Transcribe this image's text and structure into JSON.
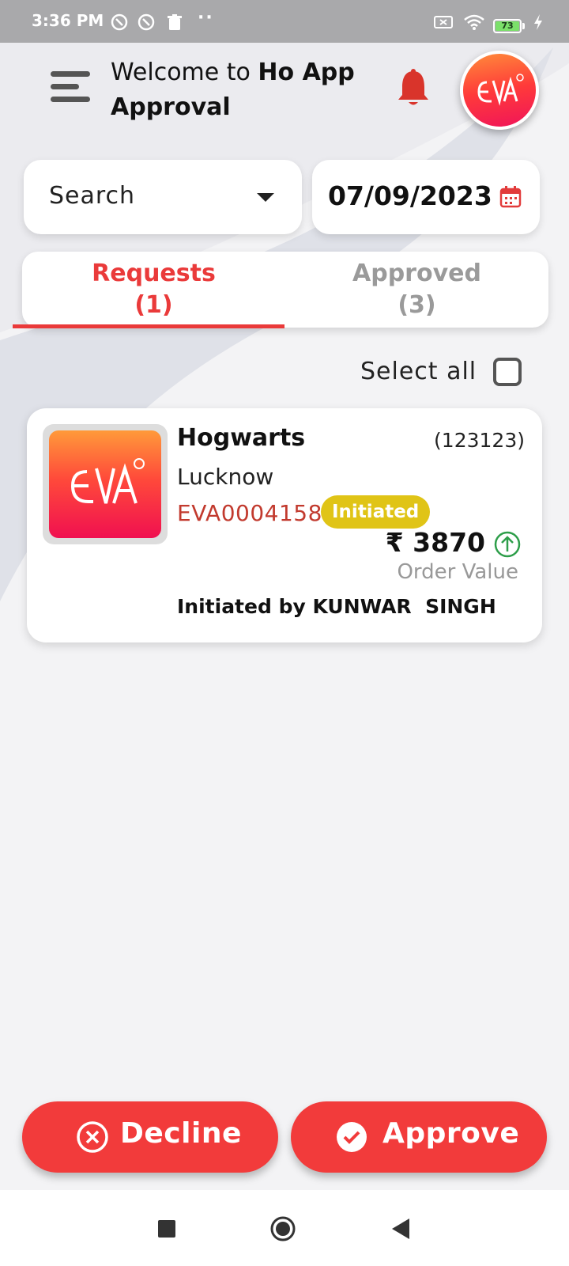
{
  "status_bar": {
    "time": "3:36 PM",
    "battery": "73"
  },
  "header": {
    "welcome_prefix": "Welcome to ",
    "welcome_bold": "Ho App",
    "title_line2": "Approval"
  },
  "filters": {
    "search_label": "Search",
    "date": "07/09/2023"
  },
  "tabs": [
    {
      "label": "Requests",
      "count": "(1)",
      "active": true
    },
    {
      "label": "Approved",
      "count": "(3)",
      "active": false
    }
  ],
  "select_all_label": "Select all",
  "requests": [
    {
      "store_name": "Hogwarts",
      "store_code": "(123123)",
      "city": "Lucknow",
      "order_id": "EVA0004158",
      "status": "Initiated",
      "amount": "₹ 3870",
      "amount_label": "Order Value",
      "initiated_by": "Initiated by KUNWAR  SINGH"
    }
  ],
  "actions": {
    "decline_label": "Decline",
    "approve_label": "Approve"
  },
  "colors": {
    "accent": "#f23b3b",
    "tab_active": "#ea3a3a",
    "status_badge": "#e0c416",
    "order_id": "#c23a2e"
  },
  "icons": {
    "menu": "hamburger-icon",
    "notification": "bell-icon",
    "calendar": "calendar-icon",
    "trend": "arrow-up-circle-icon",
    "decline": "close-circle-icon",
    "approve": "check-circle-icon"
  }
}
